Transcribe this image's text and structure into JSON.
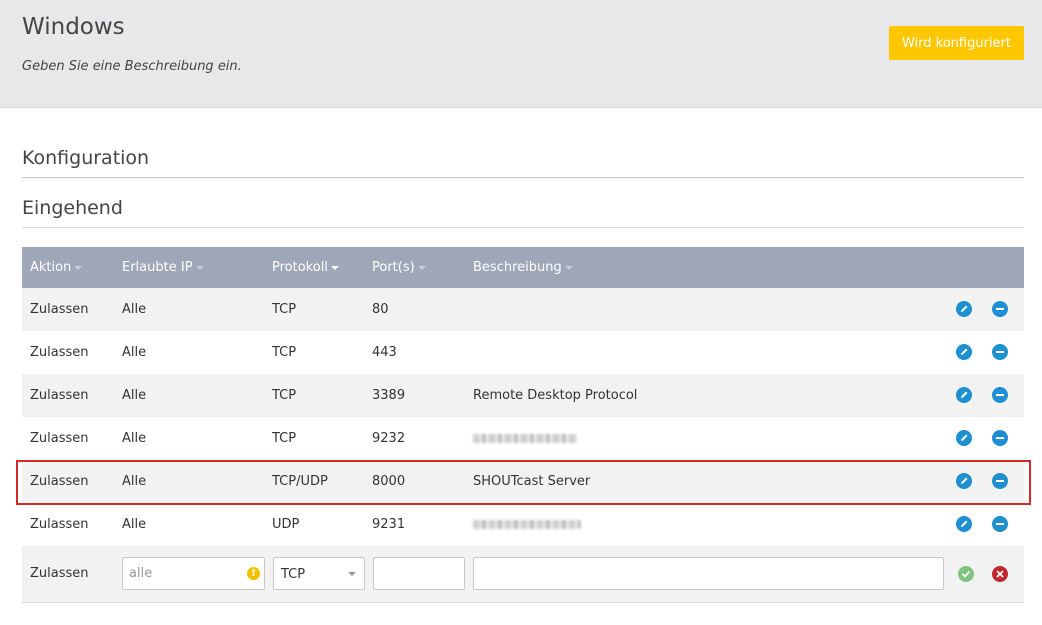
{
  "header": {
    "title": "Windows",
    "description": "Geben Sie eine Beschreibung ein.",
    "status_button": "Wird konfiguriert",
    "status_color": "#ffc700"
  },
  "sections": {
    "configuration": "Konfiguration",
    "incoming": "Eingehend"
  },
  "table": {
    "columns": [
      {
        "label": "Aktion",
        "sorted": false
      },
      {
        "label": "Erlaubte IP",
        "sorted": false
      },
      {
        "label": "Protokoll",
        "sorted": true
      },
      {
        "label": "Port(s)",
        "sorted": false
      },
      {
        "label": "Beschreibung",
        "sorted": false
      }
    ],
    "rows": [
      {
        "action": "Zulassen",
        "ip": "Alle",
        "protocol": "TCP",
        "port": "80",
        "description": ""
      },
      {
        "action": "Zulassen",
        "ip": "Alle",
        "protocol": "TCP",
        "port": "443",
        "description": ""
      },
      {
        "action": "Zulassen",
        "ip": "Alle",
        "protocol": "TCP",
        "port": "3389",
        "description": "Remote Desktop Protocol"
      },
      {
        "action": "Zulassen",
        "ip": "Alle",
        "protocol": "TCP",
        "port": "9232",
        "description": ""
      },
      {
        "action": "Zulassen",
        "ip": "Alle",
        "protocol": "TCP/UDP",
        "port": "8000",
        "description": "SHOUTcast Server"
      },
      {
        "action": "Zulassen",
        "ip": "Alle",
        "protocol": "UDP",
        "port": "9231",
        "description": ""
      }
    ],
    "row_icons": {
      "edit": "pencil-icon",
      "remove": "minus-circle-icon"
    },
    "new_rule": {
      "action": "Zulassen",
      "ip_placeholder": "alle",
      "ip_warning_icon": "warning-icon",
      "protocol_selected": "TCP",
      "port_value": "",
      "description_value": "",
      "confirm_icon": "check-icon",
      "cancel_icon": "close-icon"
    },
    "highlight_color": "#d42a2a"
  }
}
